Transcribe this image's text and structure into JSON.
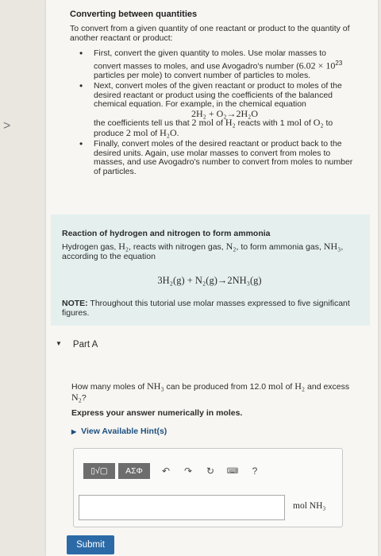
{
  "nav": {
    "side_chevron": ">"
  },
  "converting": {
    "title": "Converting between quantities",
    "intro": "To convert from a given quantity of one reactant or product to the quantity of another reactant or product:",
    "bullet_glyph": "•",
    "b1_a": "First, convert the given quantity to moles. Use molar masses to convert masses to moles, and use Avogadro's number (",
    "b1_num": "6.02 × 10",
    "b1_exp": "23",
    "b1_b": " particles per mole) to convert number of particles to moles.",
    "b2_a": "Next, convert moles of the given reactant or product to moles of the desired reactant or product using the coefficients of the balanced chemical equation. For example, in the chemical equation",
    "b2_eq": "2H₂ + O₂→2H₂O",
    "b2_b": "the coefficients tell us that ",
    "b2_mol2": "2 mol",
    "b2_of1": " of ",
    "b2_h2": "H₂",
    "b2_c": " reacts with 1 ",
    "b2_mol1": "mol",
    "b2_of2": " of ",
    "b2_o2": "O₂",
    "b2_d": " to produce ",
    "b2_mol2b": "2 mol",
    "b2_of3": " of ",
    "b2_h2o": "H₂O",
    "b2_end": ".",
    "b3": "Finally, convert moles of the desired reactant or product back to the desired units. Again, use molar masses to convert from moles to masses, and use Avogadro's number to convert from moles to number of particles."
  },
  "reaction": {
    "title": "Reaction of hydrogen and nitrogen to form ammonia",
    "t1": "Hydrogen gas, ",
    "h2": "H₂",
    "t2": ", reacts with nitrogen gas, ",
    "n2": "N₂",
    "t3": ", to form ammonia gas, ",
    "nh3": "NH₃",
    "t4": ", according to the equation",
    "equation": "3H₂(g) + N₂(g)→2NH₃(g)",
    "note_label": "NOTE:",
    "note_text": " Throughout this tutorial use molar masses expressed to five significant figures."
  },
  "part": {
    "toggle_glyph": "▼",
    "label": "Part A",
    "q1": "How many moles of ",
    "q_nh3": "NH₃",
    "q2": " can be produced from 12.0 ",
    "q_mol": "mol",
    "q3": " of ",
    "q_h2": "H₂",
    "q4": " and excess ",
    "q_n2": "N₂",
    "q5": "?",
    "instruction": "Express your answer numerically in moles.",
    "hint_glyph": "▶",
    "hint_label": "View Available Hint(s)"
  },
  "toolbar": {
    "templates_label": "▯√▢",
    "symbols_label": "ΑΣΦ",
    "undo_glyph": "↶",
    "redo_glyph": "↷",
    "reset_glyph": "↻",
    "keyboard_glyph": "⌨",
    "help_glyph": "?"
  },
  "answer": {
    "value": "",
    "unit": "mol NH₃"
  },
  "submit_label": "Submit"
}
